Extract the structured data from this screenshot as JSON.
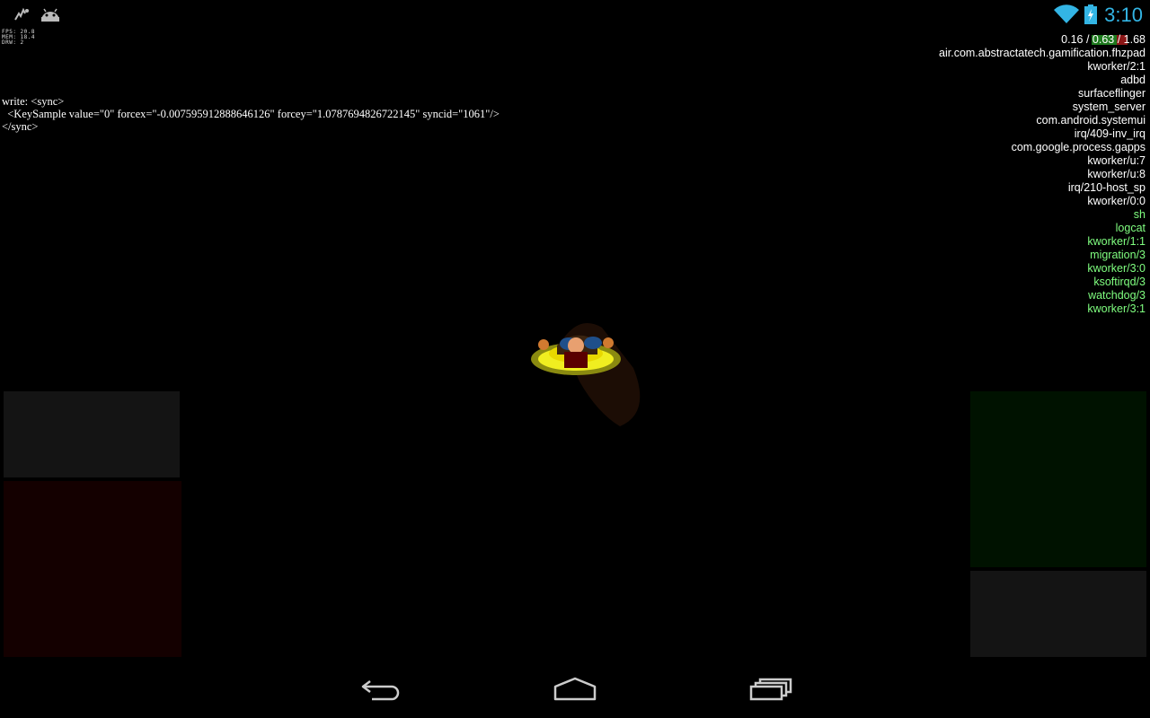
{
  "status_bar": {
    "left_icons": [
      "debug-icon",
      "android-icon"
    ],
    "right_icons": [
      "wifi-icon",
      "battery-icon"
    ],
    "time": "3:10",
    "accent_color": "#33b5e5"
  },
  "fps_overlay": {
    "fps": "FPS: 20.8",
    "mem": "MEM: 18.4",
    "drw": "DRW: 2"
  },
  "sync_log": {
    "line1": "write: <sync>",
    "line2": "  <KeySample value=\"0\" forcex=\"-0.007595912888646126\" forcey=\"1.0787694826722145\" syncid=\"1061\"/>",
    "line3": "</sync>"
  },
  "cpu_overlay": {
    "load_average": "0.16 / 0.63 / 1.68",
    "processes_white": [
      "air.com.abstractatech.gamification.fhzpad",
      "kworker/2:1",
      "adbd",
      "surfaceflinger",
      "system_server",
      "com.android.systemui",
      "irq/409-inv_irq",
      "com.google.process.gapps",
      "kworker/u:7",
      "kworker/u:8",
      "irq/210-host_sp",
      "kworker/0:0"
    ],
    "processes_green": [
      "sh",
      "logcat",
      "kworker/1:1",
      "migration/3",
      "kworker/3:0",
      "ksoftirqd/3",
      "watchdog/3",
      "kworker/3:1"
    ],
    "white_color": "#ffffff",
    "green_color": "#80ff80"
  },
  "game": {
    "character": "player-sprite",
    "pads": {
      "left_top_color": "#141414",
      "left_bottom_color": "#140000",
      "right_top_color": "#001200",
      "right_bottom_color": "#141414"
    }
  },
  "nav_bar": {
    "buttons": [
      "back-icon",
      "home-icon",
      "recent-apps-icon"
    ]
  }
}
